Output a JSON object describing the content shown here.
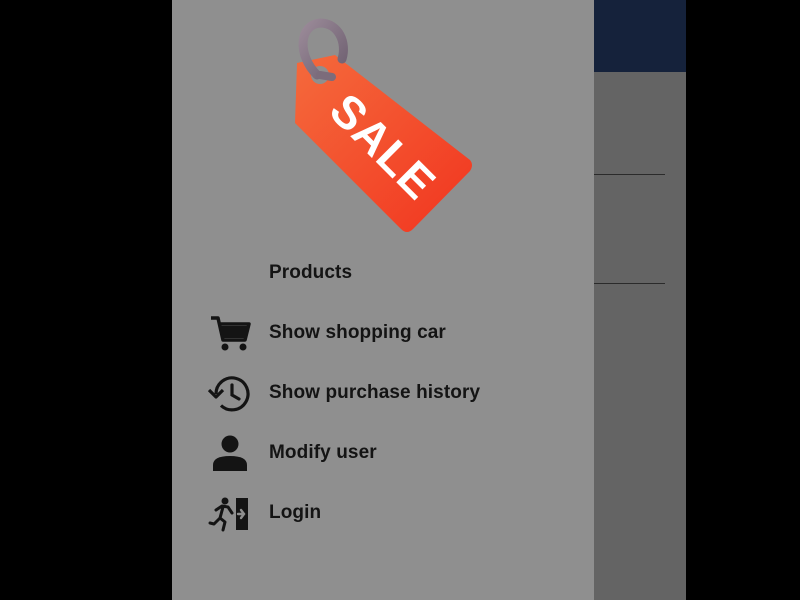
{
  "drawer": {
    "logo": {
      "text": "SALE",
      "icon": "sale-tag-icon"
    },
    "menu": [
      {
        "label": "Products",
        "icon": "none"
      },
      {
        "label": "Show shopping car",
        "icon": "shopping-cart-icon"
      },
      {
        "label": "Show purchase history",
        "icon": "history-clock-icon"
      },
      {
        "label": "Modify user",
        "icon": "person-icon"
      },
      {
        "label": "Login",
        "icon": "login-exit-icon"
      }
    ]
  },
  "colors": {
    "toolbar": "#15223b",
    "drawer_background": "#8f8f8f",
    "scrim_content": "#646464",
    "tag_red": "#f44b2a",
    "text": "#141414"
  }
}
